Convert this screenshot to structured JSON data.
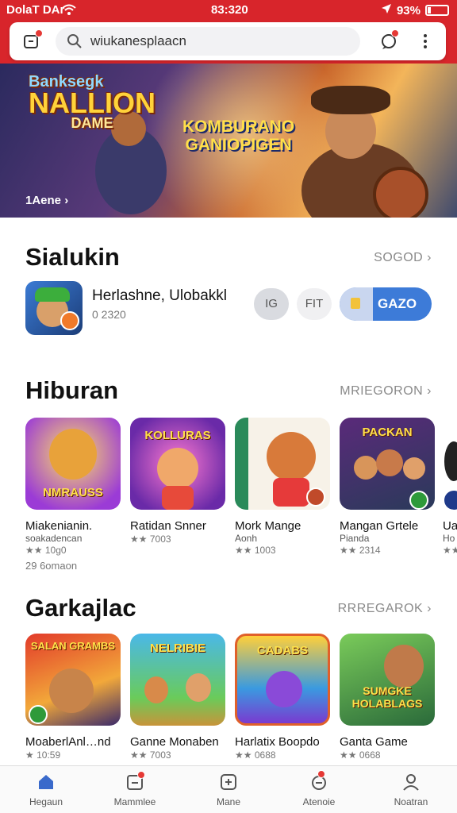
{
  "status_bar": {
    "carrier": "DolaT DAr",
    "time": "83:320",
    "battery": "93%"
  },
  "search": {
    "placeholder": "wiukanesplaacn"
  },
  "banner": {
    "logo_small": "Banksegk",
    "logo_main": "NALLION",
    "logo_sub": "DAME",
    "logo2_line1": "KOMBURANO",
    "logo2_line2": "GANIOPIGEN",
    "cta": "1Aene"
  },
  "featured": {
    "title": "Sialukin",
    "more": "SOGOD",
    "app_name": "Herlashne, Ulobakkl",
    "app_meta": "0 2320",
    "btn1": "IG",
    "btn2": "FIT",
    "btn_primary": "GAZO"
  },
  "hiburan": {
    "title": "Hiburan",
    "more": "MRIEGORON",
    "items": [
      {
        "title": "Miakenianin.",
        "sub": "soakadencan",
        "meta": "★★ 10g0",
        "meta2": "29 6omaon",
        "thumb_word": "NMRAUSS"
      },
      {
        "title": "Ratidan Snner",
        "sub": "",
        "meta": "★★ 7003",
        "thumb_word": "KOLLURAS"
      },
      {
        "title": "Mork Mange",
        "sub": "Aonh",
        "meta": "★★ 1003",
        "thumb_word": ""
      },
      {
        "title": "Mangan Grtele",
        "sub": "Pianda",
        "meta": "★★ 2314",
        "thumb_word": "PACKAN"
      },
      {
        "title": "Ua",
        "sub": "Ho",
        "meta": "★★",
        "thumb_word": ""
      }
    ]
  },
  "garkajlan": {
    "title": "Garkajlac",
    "more": "RRREGAROK",
    "items": [
      {
        "title": "MoaberlAnl…nd",
        "meta": "★ 10:59",
        "thumb_word": "SALAN GRAMBS"
      },
      {
        "title": "Ganne Monaben",
        "meta": "★★ 7003",
        "thumb_word": "NELRIBIE"
      },
      {
        "title": "Harlatix Boopdo",
        "meta": "★★ 0688",
        "thumb_word": "CADABS"
      },
      {
        "title": "Ganta Game",
        "meta": "★★ 0668",
        "thumb_word": "SUMGKE HOLABLAGS"
      }
    ]
  },
  "nav": [
    {
      "label": "Hegaun",
      "icon": "home-icon"
    },
    {
      "label": "Mammlee",
      "icon": "apps-icon"
    },
    {
      "label": "Mane",
      "icon": "add-icon"
    },
    {
      "label": "Atenoie",
      "icon": "notifications-icon"
    },
    {
      "label": "Noatran",
      "icon": "profile-icon"
    }
  ],
  "colors": {
    "brand_red": "#d8252b",
    "primary_blue": "#3d7bd8"
  }
}
